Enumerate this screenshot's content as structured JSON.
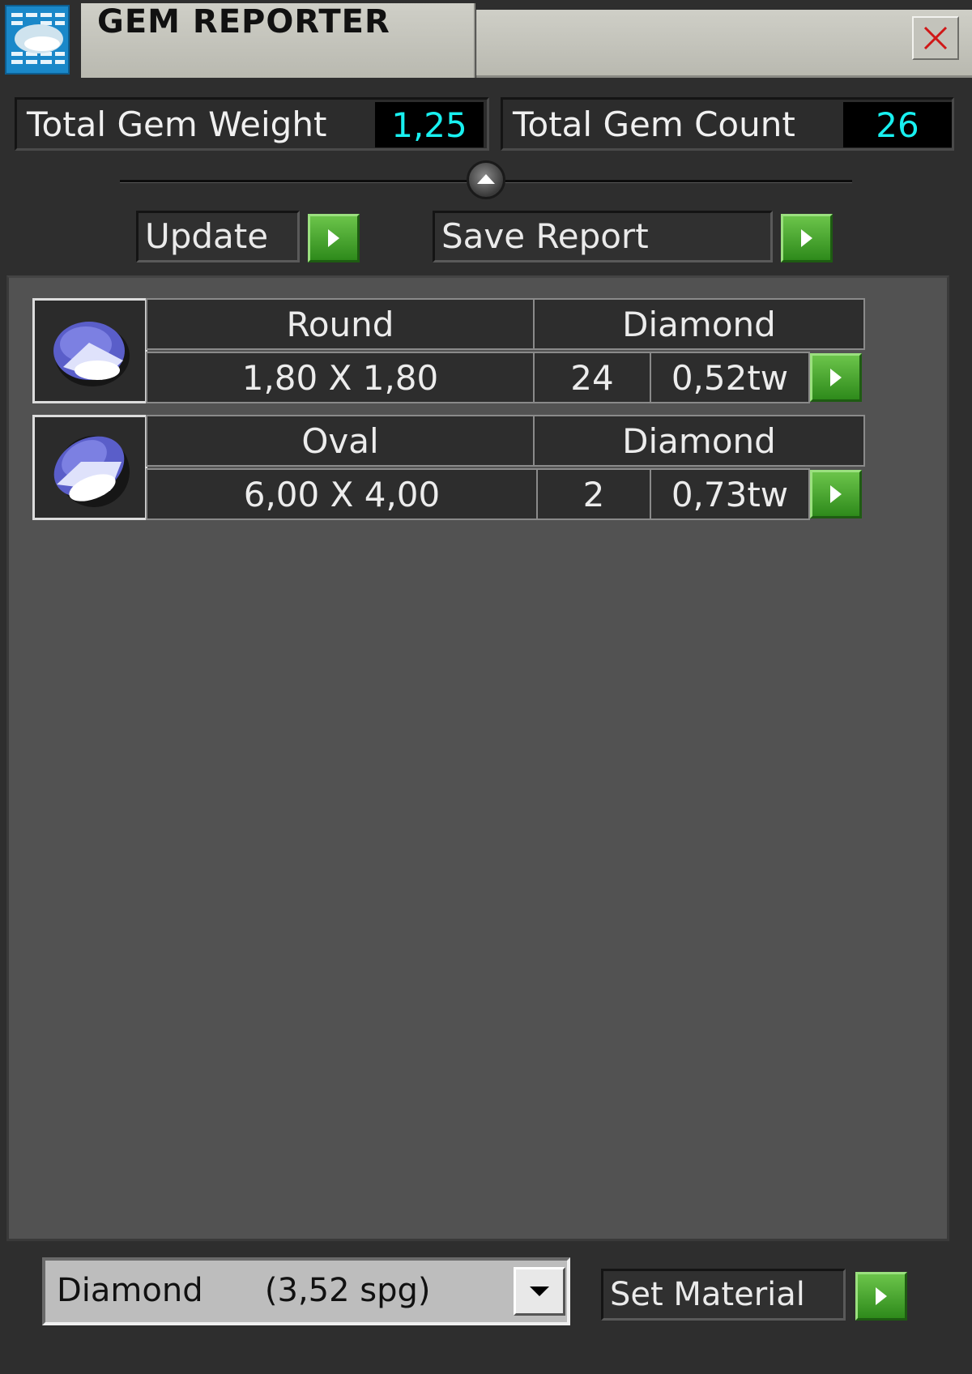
{
  "window": {
    "title": "GEM REPORTER"
  },
  "totals": {
    "weight_label": "Total Gem Weight",
    "weight_value": "1,25",
    "count_label": "Total Gem Count",
    "count_value": "26"
  },
  "actions": {
    "update_label": "Update",
    "save_label": "Save Report"
  },
  "gems": [
    {
      "shape": "Round",
      "material": "Diamond",
      "size": "1,80 X 1,80",
      "count": "24",
      "weight": "0,52tw"
    },
    {
      "shape": "Oval",
      "material": "Diamond",
      "size": "6,00 X 4,00",
      "count": "2",
      "weight": "0,73tw"
    }
  ],
  "material": {
    "selected": "Diamond      (3,52 spg)",
    "set_label": "Set Material"
  },
  "colors": {
    "accent_green": "#3aa526",
    "value_cyan": "#18f0f0",
    "panel": "#525252"
  },
  "icons": [
    "app-icon",
    "close-icon",
    "collapse-up-icon",
    "play-arrow-icon",
    "gem-icon",
    "dropdown-arrow-icon"
  ]
}
